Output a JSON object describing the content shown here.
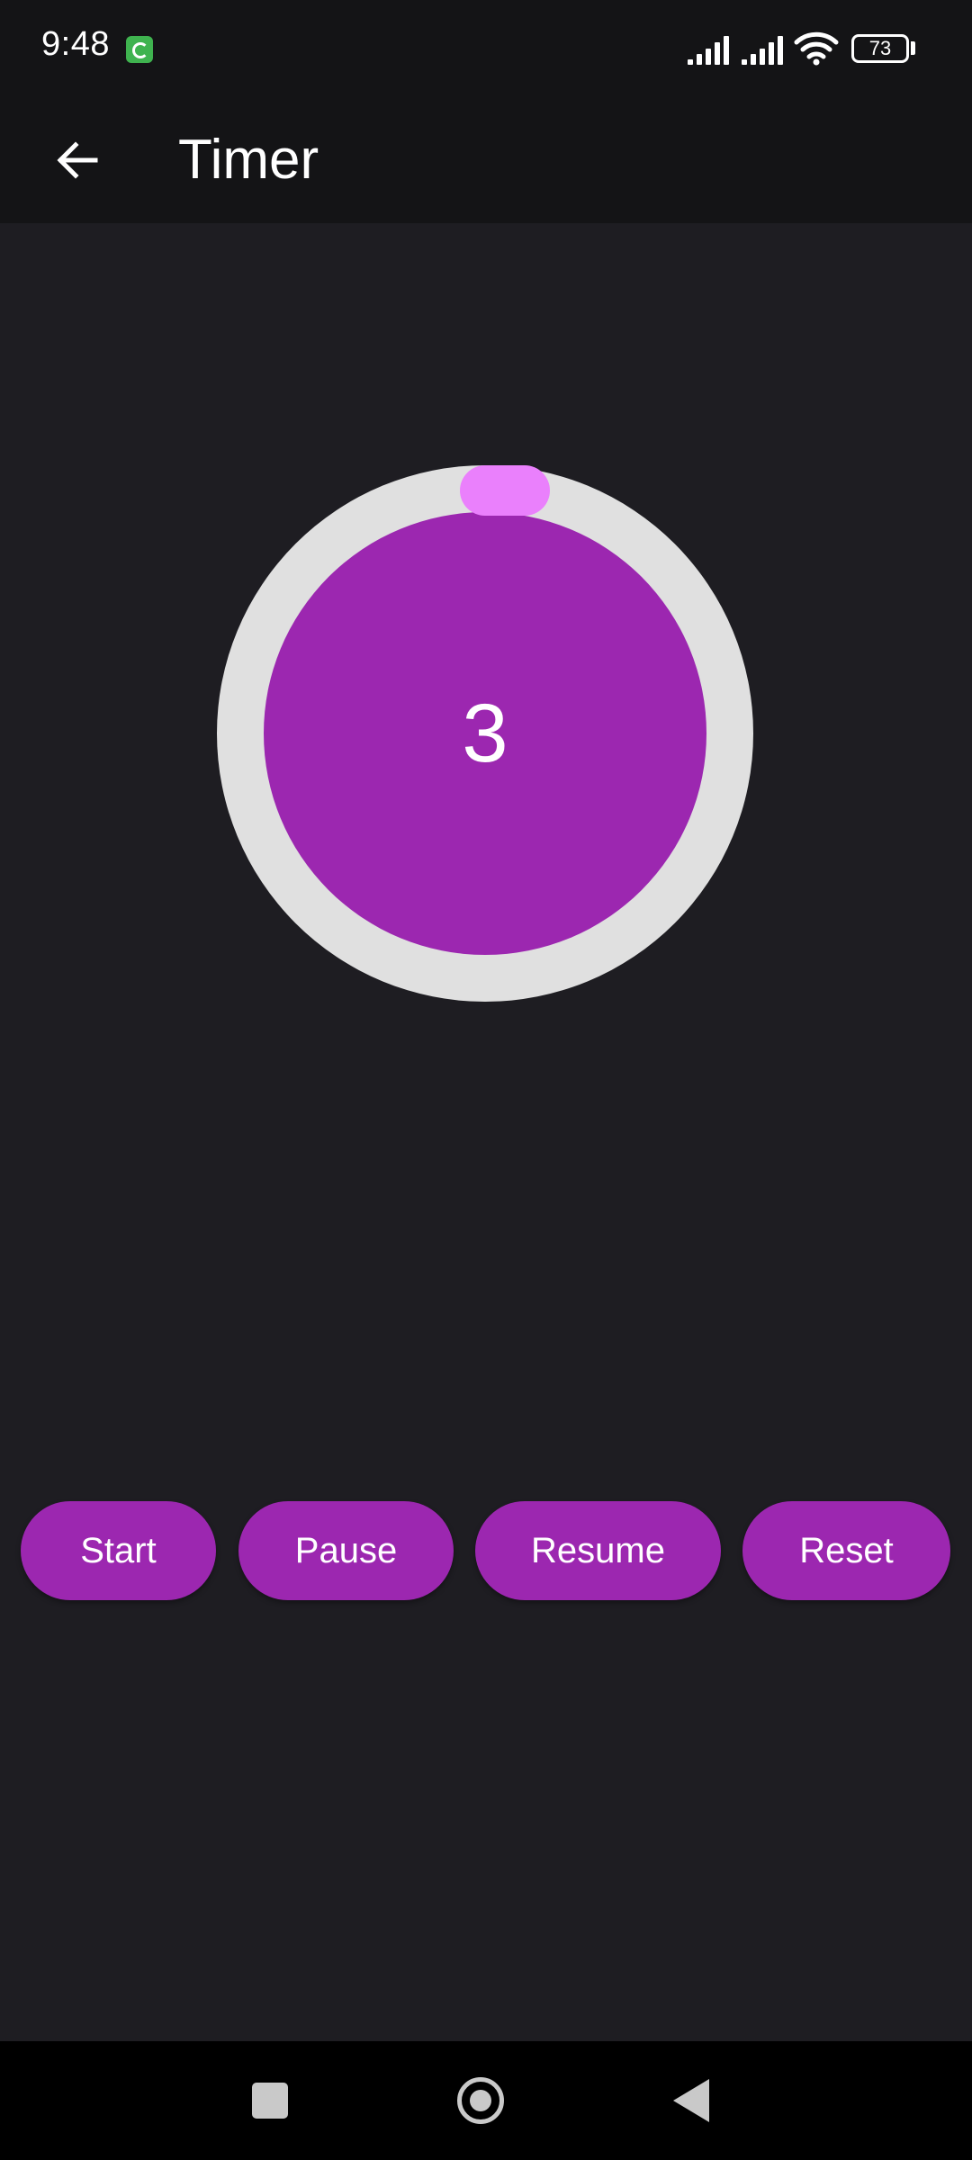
{
  "status_bar": {
    "time": "9:48",
    "battery_level": "73",
    "icons": [
      "app-notification-icon",
      "signal-icon",
      "signal-icon",
      "wifi-icon",
      "battery-icon"
    ]
  },
  "app_bar": {
    "title": "Timer",
    "back_icon": "arrow-left-icon"
  },
  "timer": {
    "value": "3",
    "progress": 0.03,
    "colors": {
      "track": "#e0e0e0",
      "fill": "#9c27b0",
      "indicator": "#ea80fc"
    }
  },
  "buttons": {
    "start": "Start",
    "pause": "Pause",
    "resume": "Resume",
    "reset": "Reset"
  },
  "nav_bar": {
    "icons": [
      "recents-icon",
      "home-icon",
      "back-icon"
    ]
  },
  "colors": {
    "background": "#1e1d22",
    "app_bar": "#141416",
    "accent": "#9c27b0"
  }
}
